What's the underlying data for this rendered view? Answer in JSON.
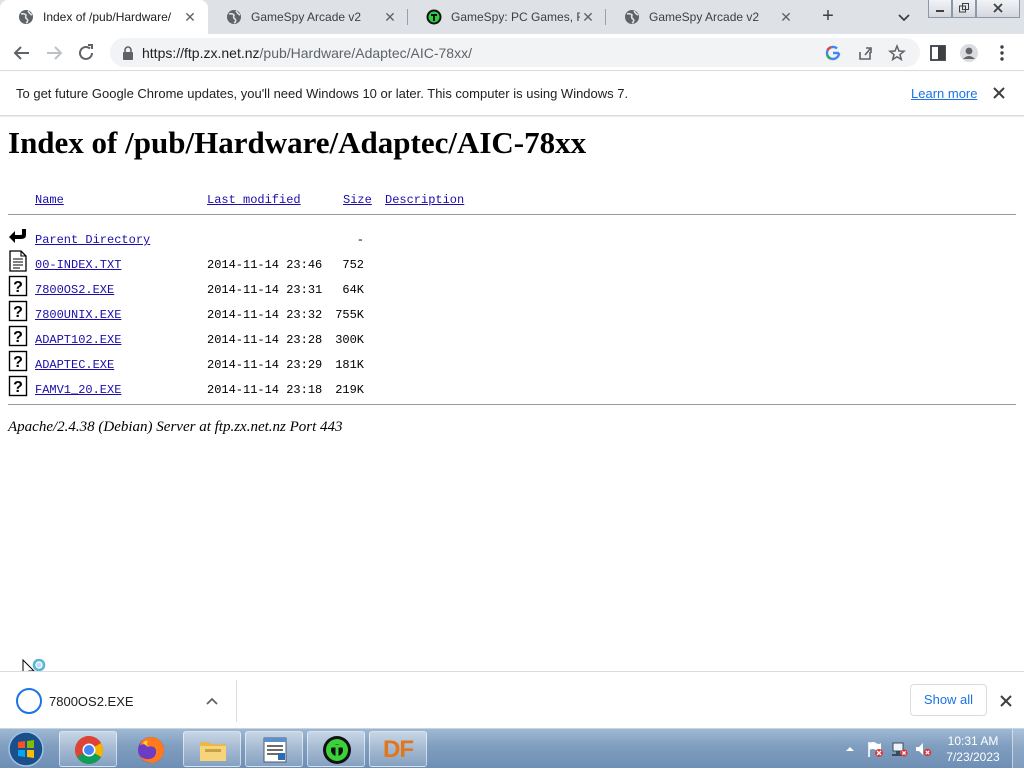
{
  "browser": {
    "tabs": [
      {
        "title": "Index of /pub/Hardware/",
        "active": true,
        "favicon": "globe-icon"
      },
      {
        "title": "GameSpy Arcade v2",
        "active": false,
        "favicon": "globe-icon"
      },
      {
        "title": "GameSpy: PC Games, Rev",
        "active": false,
        "favicon": "gamespy-icon"
      },
      {
        "title": "GameSpy Arcade v2",
        "active": false,
        "favicon": "globe-icon"
      }
    ],
    "url_host": "https://ftp.zx.net.nz",
    "url_path": "/pub/Hardware/Adaptec/AIC-78xx/"
  },
  "infobar": {
    "message": "To get future Google Chrome updates, you'll need Windows 10 or later. This computer is using Windows 7.",
    "link": "Learn more"
  },
  "page": {
    "heading": "Index of /pub/Hardware/Adaptec/AIC-78xx",
    "columns": {
      "name": "Name",
      "modified": "Last modified",
      "size": "Size",
      "description": "Description"
    },
    "rows": [
      {
        "icon": "back-arrow-icon",
        "name": "Parent Directory",
        "modified": "",
        "size": "-"
      },
      {
        "icon": "text-file-icon",
        "name": "00-INDEX.TXT",
        "modified": "2014-11-14 23:46",
        "size": "752"
      },
      {
        "icon": "unknown-file-icon",
        "name": "7800OS2.EXE",
        "modified": "2014-11-14 23:31",
        "size": "64K"
      },
      {
        "icon": "unknown-file-icon",
        "name": "7800UNIX.EXE",
        "modified": "2014-11-14 23:32",
        "size": "755K"
      },
      {
        "icon": "unknown-file-icon",
        "name": "ADAPT102.EXE",
        "modified": "2014-11-14 23:28",
        "size": "300K"
      },
      {
        "icon": "unknown-file-icon",
        "name": "ADAPTEC.EXE",
        "modified": "2014-11-14 23:29",
        "size": "181K"
      },
      {
        "icon": "unknown-file-icon",
        "name": "FAMV1_20.EXE",
        "modified": "2014-11-14 23:18",
        "size": "219K"
      }
    ],
    "address": "Apache/2.4.38 (Debian) Server at ftp.zx.net.nz Port 443"
  },
  "downloads": {
    "file": "7800OS2.EXE",
    "show_all": "Show all"
  },
  "taskbar": {
    "apps": [
      "chrome-icon",
      "firefox-icon",
      "explorer-icon",
      "notepad-icon",
      "gamespy-icon",
      "df-icon"
    ],
    "df_label": "DF",
    "time": "10:31 AM",
    "date": "7/23/2023"
  },
  "colors": {
    "link": "#1a0dab",
    "accent": "#1a73e8",
    "taskbar": "#7f9dbf"
  }
}
